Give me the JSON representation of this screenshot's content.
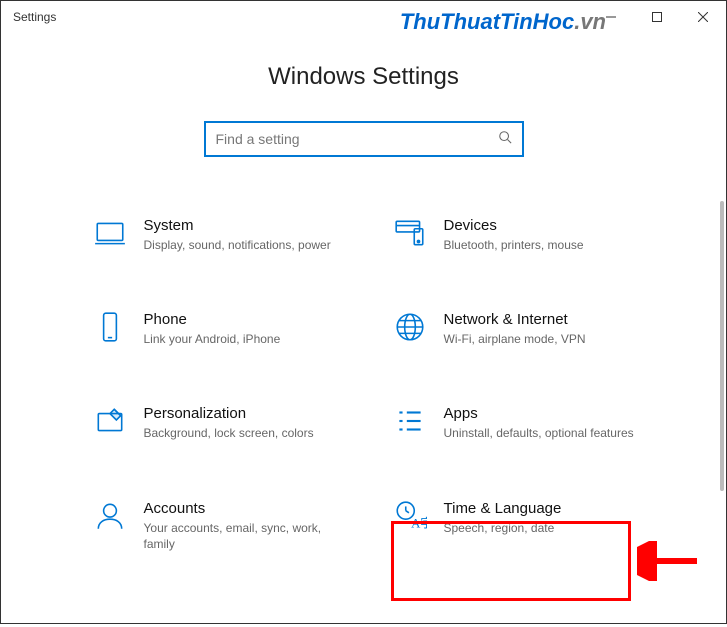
{
  "window": {
    "title": "Settings"
  },
  "watermark": {
    "main": "ThuThuatTinHoc",
    "suffix": ".vn"
  },
  "header": {
    "title": "Windows Settings"
  },
  "search": {
    "placeholder": "Find a setting",
    "value": ""
  },
  "tiles": [
    {
      "id": "system",
      "title": "System",
      "desc": "Display, sound, notifications, power"
    },
    {
      "id": "devices",
      "title": "Devices",
      "desc": "Bluetooth, printers, mouse"
    },
    {
      "id": "phone",
      "title": "Phone",
      "desc": "Link your Android, iPhone"
    },
    {
      "id": "network",
      "title": "Network & Internet",
      "desc": "Wi-Fi, airplane mode, VPN"
    },
    {
      "id": "personalization",
      "title": "Personalization",
      "desc": "Background, lock screen, colors"
    },
    {
      "id": "apps",
      "title": "Apps",
      "desc": "Uninstall, defaults, optional features"
    },
    {
      "id": "accounts",
      "title": "Accounts",
      "desc": "Your accounts, email, sync, work, family"
    },
    {
      "id": "time-language",
      "title": "Time & Language",
      "desc": "Speech, region, date"
    }
  ],
  "annotation": {
    "highlighted_tile": "time-language"
  },
  "colors": {
    "accent": "#0078d4",
    "highlight": "#ff0000",
    "arrow": "#ff0000"
  }
}
